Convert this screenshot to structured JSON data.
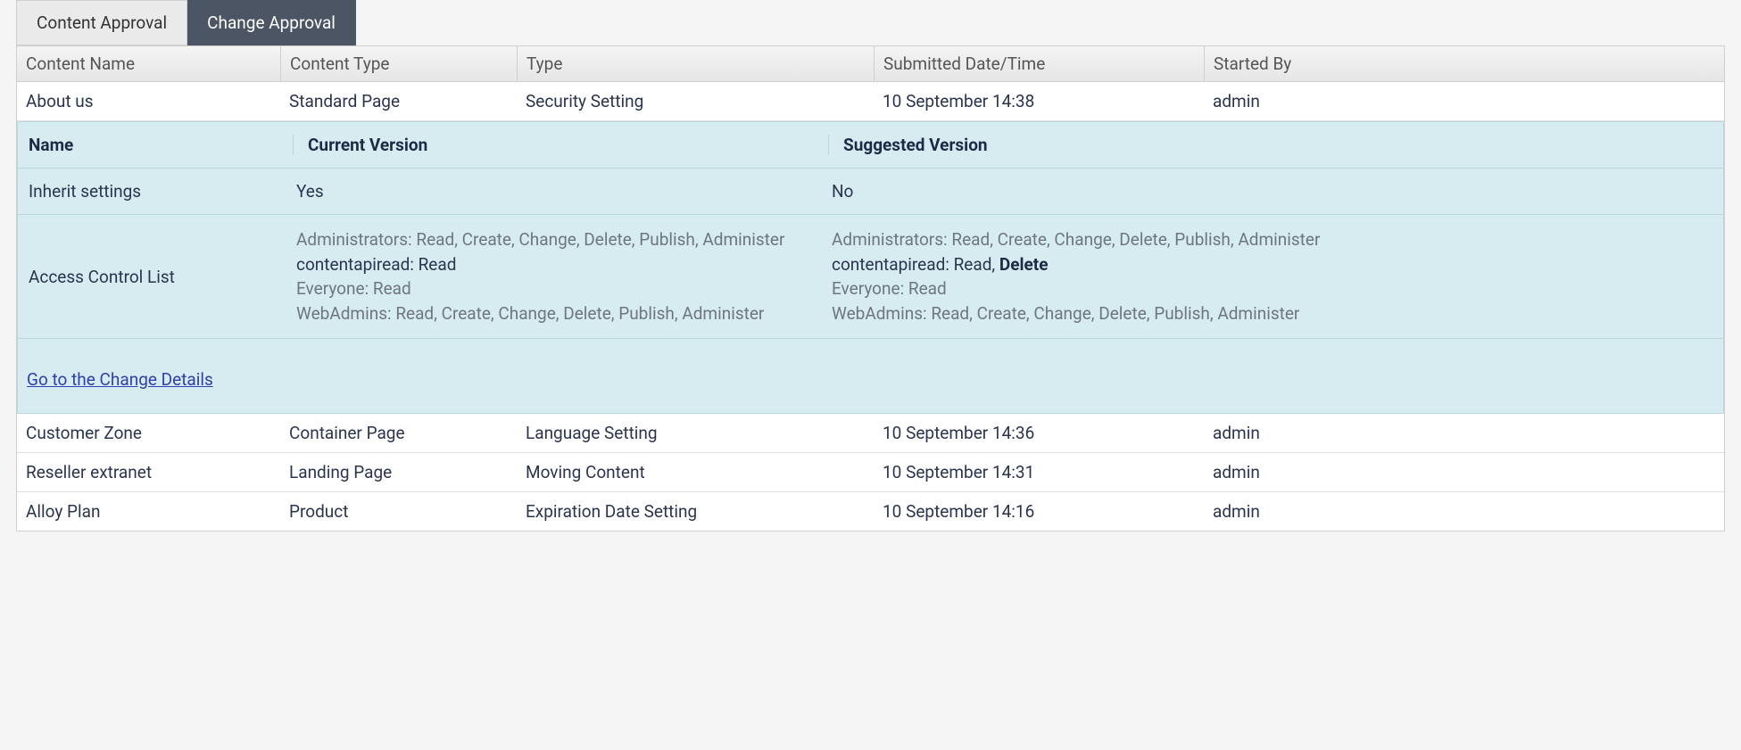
{
  "tabs": {
    "content_approval": "Content Approval",
    "change_approval": "Change Approval"
  },
  "columns": {
    "content_name": "Content Name",
    "content_type": "Content Type",
    "type": "Type",
    "submitted": "Submitted Date/Time",
    "started_by": "Started By"
  },
  "rows": [
    {
      "content_name": "About us",
      "content_type": "Standard Page",
      "type": "Security Setting",
      "submitted": "10 September 14:38",
      "started_by": "admin"
    },
    {
      "content_name": "Customer Zone",
      "content_type": "Container Page",
      "type": "Language Setting",
      "submitted": "10 September 14:36",
      "started_by": "admin"
    },
    {
      "content_name": "Reseller extranet",
      "content_type": "Landing Page",
      "type": "Moving Content",
      "submitted": "10 September 14:31",
      "started_by": "admin"
    },
    {
      "content_name": "Alloy Plan",
      "content_type": "Product",
      "type": "Expiration Date Setting",
      "submitted": "10 September 14:16",
      "started_by": "admin"
    }
  ],
  "detail": {
    "headers": {
      "name": "Name",
      "current": "Current Version",
      "suggested": "Suggested Version"
    },
    "inherit_label": "Inherit settings",
    "inherit_current": "Yes",
    "inherit_suggested": "No",
    "acl_label": "Access Control List",
    "acl_current": {
      "admins": "Administrators: Read, Create, Change, Delete, Publish, Administer",
      "contentapi_name": "contentapiread: Read",
      "everyone": "Everyone: Read",
      "webadmins": "WebAdmins: Read, Create, Change, Delete, Publish, Administer"
    },
    "acl_suggested": {
      "admins": "Administrators: Read, Create, Change, Delete, Publish, Administer",
      "contentapi_name": "contentapiread: Read, ",
      "contentapi_bold": "Delete",
      "everyone": "Everyone: Read",
      "webadmins": "WebAdmins: Read, Create, Change, Delete, Publish, Administer"
    },
    "link": "Go to the Change Details"
  }
}
